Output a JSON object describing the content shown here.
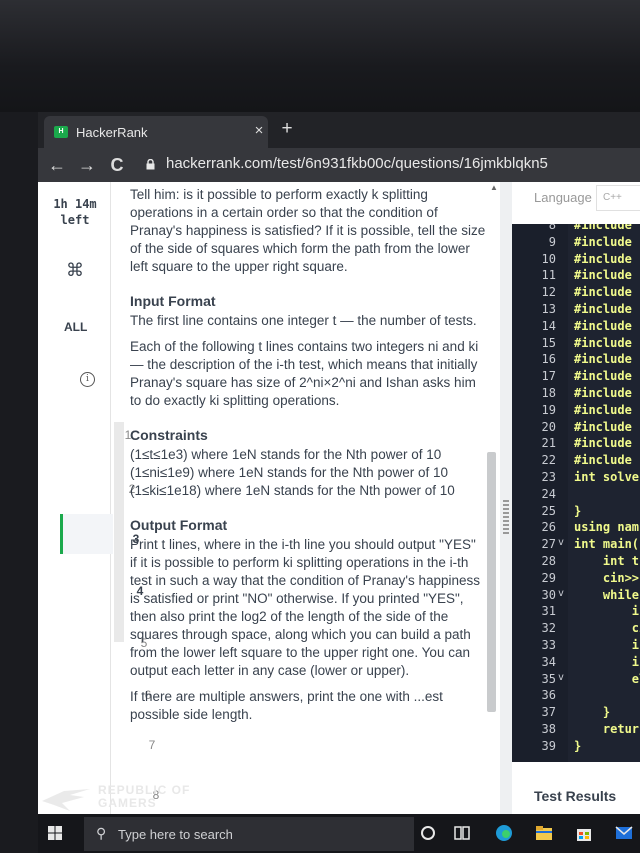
{
  "browser": {
    "tab_title": "HackerRank",
    "tab_close": "×",
    "new_tab": "+",
    "nav_back": "←",
    "nav_forward": "→",
    "nav_reload": "C",
    "url": "hackerrank.com/test/6n931fkb00c/questions/16jmkblqkn5"
  },
  "rail": {
    "timer": "1h 14m left",
    "command_icon": "⌘",
    "all_label": "ALL",
    "info_icon": "i",
    "questions": [
      "1",
      "2",
      "3",
      "4",
      "5",
      "6",
      "7",
      "8"
    ],
    "active_question": "3"
  },
  "problem": {
    "intro": "Tell him: is it possible to perform exactly k splitting operations in a certain order so that the condition of Pranay's happiness is satisfied? If it is possible, tell the size of the side of squares which form the path from the lower left square to the upper right square.",
    "input_heading": "Input Format",
    "input_p1": "The first line contains one integer t — the number of tests.",
    "input_p2": "Each of the following t lines contains two integers ni and ki — the description of the i-th test, which means that initially Pranay's square has size of 2^ni×2^ni and Ishan asks him to do exactly ki splitting operations.",
    "constraints_heading": "Constraints",
    "constraints_text": "(1≤t≤1e3) where 1eN stands for the Nth power of 10 (1≤ni≤1e9) where 1eN stands for the Nth power of 10 (1≤ki≤1e18) where 1eN stands for the Nth power of 10",
    "output_heading": "Output Format",
    "output_p1": "Print t lines, where in the i-th line you should output \"YES\" if it is possible to perform ki splitting operations in the i-th test in such a way that the condition of Pranay's happiness is satisfied or print \"NO\" otherwise. If you printed \"YES\", then also print the log2 of the length of the side of the squares through space, along which you can build a path from the lower left square to the upper right one. You can output each letter in any case (lower or upper).",
    "output_p2": "If there are multiple answers, print the one with ...est possible side length."
  },
  "editor": {
    "language_label": "Language",
    "language_value": "C++",
    "lines": [
      {
        "n": "8",
        "code": "#include",
        "fold": ""
      },
      {
        "n": "9",
        "code": "#include",
        "fold": ""
      },
      {
        "n": "10",
        "code": "#include",
        "fold": ""
      },
      {
        "n": "11",
        "code": "#include",
        "fold": ""
      },
      {
        "n": "12",
        "code": "#include",
        "fold": ""
      },
      {
        "n": "13",
        "code": "#include",
        "fold": ""
      },
      {
        "n": "14",
        "code": "#include",
        "fold": ""
      },
      {
        "n": "15",
        "code": "#include",
        "fold": ""
      },
      {
        "n": "16",
        "code": "#include",
        "fold": ""
      },
      {
        "n": "17",
        "code": "#include",
        "fold": ""
      },
      {
        "n": "18",
        "code": "#include",
        "fold": ""
      },
      {
        "n": "19",
        "code": "#include",
        "fold": ""
      },
      {
        "n": "20",
        "code": "#include",
        "fold": ""
      },
      {
        "n": "21",
        "code": "#include",
        "fold": ""
      },
      {
        "n": "22",
        "code": "#include",
        "fold": ""
      },
      {
        "n": "23",
        "code": "int solve",
        "fold": ""
      },
      {
        "n": "24",
        "code": "",
        "fold": ""
      },
      {
        "n": "25",
        "code": "}",
        "fold": ""
      },
      {
        "n": "26",
        "code": "using nam",
        "fold": ""
      },
      {
        "n": "27",
        "code": "int main(",
        "fold": "v"
      },
      {
        "n": "28",
        "code": "    int t",
        "fold": ""
      },
      {
        "n": "29",
        "code": "    cin>>",
        "fold": ""
      },
      {
        "n": "30",
        "code": "    while(",
        "fold": "v"
      },
      {
        "n": "31",
        "code": "        in",
        "fold": ""
      },
      {
        "n": "32",
        "code": "        ci",
        "fold": ""
      },
      {
        "n": "33",
        "code": "        in",
        "fold": ""
      },
      {
        "n": "34",
        "code": "        if",
        "fold": ""
      },
      {
        "n": "35",
        "code": "        el",
        "fold": "v"
      },
      {
        "n": "36",
        "code": "",
        "fold": ""
      },
      {
        "n": "37",
        "code": "    }",
        "fold": ""
      },
      {
        "n": "38",
        "code": "    return",
        "fold": ""
      },
      {
        "n": "39",
        "code": "}",
        "fold": ""
      }
    ],
    "test_results": "Test Results"
  },
  "taskbar": {
    "search_placeholder": "Type here to search"
  },
  "brand": {
    "line1": "REPUBLIC OF",
    "line2": "GAMERS"
  },
  "colors": {
    "hackerrank_green": "#1ba94c",
    "editor_bg": "#1e2330",
    "code_text": "#f1fa8c",
    "problem_text": "#39424e"
  }
}
